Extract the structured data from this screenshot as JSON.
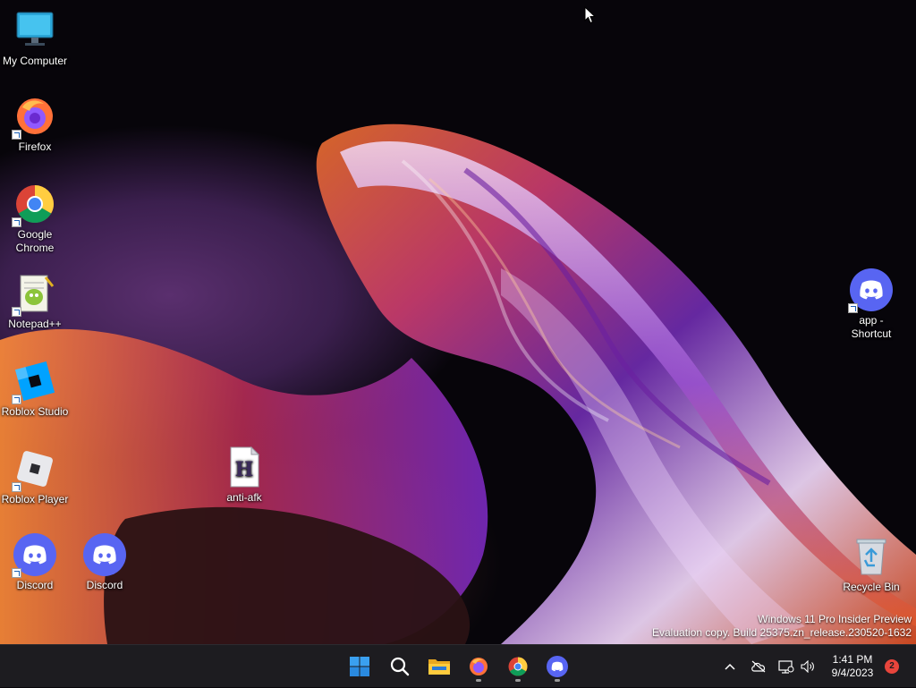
{
  "desktop_icons": {
    "my_computer": "My Computer",
    "firefox": "Firefox",
    "chrome": "Google Chrome",
    "notepadpp": "Notepad++",
    "roblox_studio": "Roblox Studio",
    "roblox_player": "Roblox Player",
    "anti_afk": "anti-afk",
    "discord_1": "Discord",
    "discord_2": "Discord",
    "app_shortcut": "app - Shortcut",
    "recycle_bin": "Recycle Bin"
  },
  "watermark": {
    "line1": "Windows 11 Pro Insider Preview",
    "line2": "Evaluation copy. Build 25375.zn_release.230520-1632"
  },
  "taskbar": {
    "apps": [
      "start-icon",
      "search-icon",
      "file-explorer-icon",
      "firefox-icon",
      "chrome-icon",
      "discord-icon"
    ],
    "clock_time": "1:41 PM",
    "clock_date": "9/4/2023",
    "notification_count": "2"
  },
  "colors": {
    "discord": "#5865f2",
    "taskbar": "#1d1c20",
    "badge": "#e8453c"
  }
}
